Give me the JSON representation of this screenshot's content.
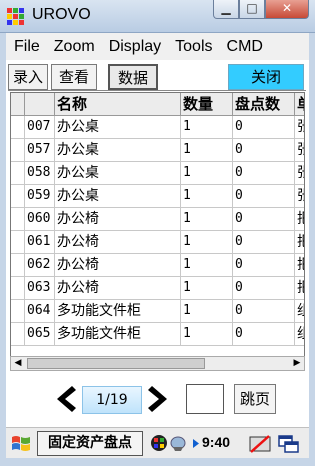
{
  "window": {
    "title": "UROVO"
  },
  "menu": [
    "File",
    "Zoom",
    "Display",
    "Tools",
    "CMD"
  ],
  "tabs": [
    {
      "label": "录入"
    },
    {
      "label": "查看"
    },
    {
      "label": "数据"
    }
  ],
  "close_label": "关闭",
  "table": {
    "headers": [
      "",
      "名称",
      "数量",
      "盘点数",
      "单"
    ],
    "rows": [
      [
        "007",
        "办公桌",
        "1",
        "0",
        "张"
      ],
      [
        "057",
        "办公桌",
        "1",
        "0",
        "张"
      ],
      [
        "058",
        "办公桌",
        "1",
        "0",
        "张"
      ],
      [
        "059",
        "办公桌",
        "1",
        "0",
        "张"
      ],
      [
        "060",
        "办公椅",
        "1",
        "0",
        "把"
      ],
      [
        "061",
        "办公椅",
        "1",
        "0",
        "把"
      ],
      [
        "062",
        "办公椅",
        "1",
        "0",
        "把"
      ],
      [
        "063",
        "办公椅",
        "1",
        "0",
        "把"
      ],
      [
        "064",
        "多功能文件柜",
        "1",
        "0",
        "组"
      ],
      [
        "065",
        "多功能文件柜",
        "1",
        "0",
        "组"
      ]
    ]
  },
  "pager": {
    "page": "1/19",
    "input_value": "",
    "jump_label": "跳页"
  },
  "taskbar": {
    "app_label": "固定资产盘点",
    "clock": "9:40"
  },
  "colors": {
    "accent": "#33ccff",
    "page_box": "#cfeaff"
  }
}
